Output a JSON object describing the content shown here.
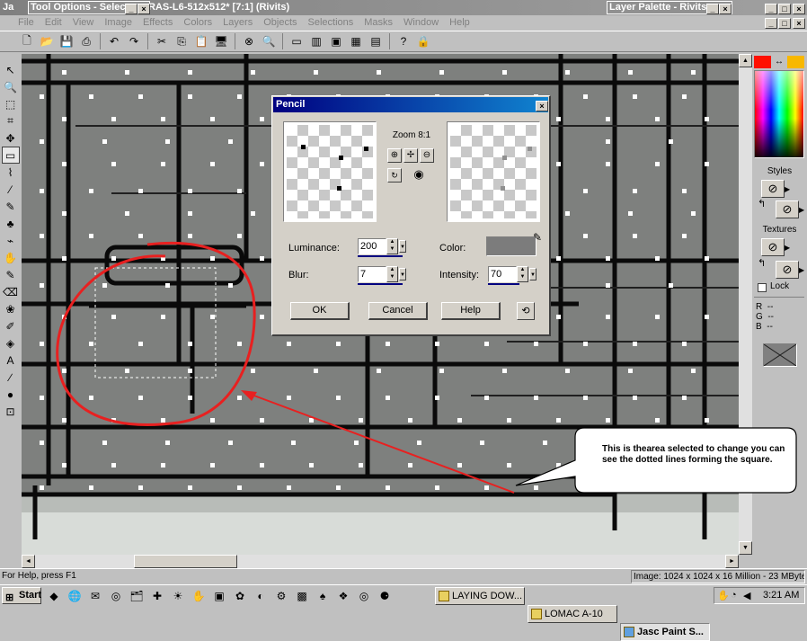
{
  "app": {
    "title_fragment": "Ja",
    "image_title": "RAS-L6-512x512* [7:1] (Rivits)"
  },
  "tool_options": {
    "title": "Tool Options - Selec"
  },
  "layer_palette": {
    "title": "Layer Palette - Rivits"
  },
  "menu": {
    "items": [
      "File",
      "Edit",
      "View",
      "Image",
      "Effects",
      "Colors",
      "Layers",
      "Objects",
      "Selections",
      "Masks",
      "Window",
      "Help"
    ]
  },
  "toolbar": {
    "icons": [
      "new-icon",
      "open-icon",
      "save-icon",
      "print-icon",
      "undo-icon",
      "redo-icon",
      "cut-icon",
      "copy-icon",
      "paste-icon",
      "browse-icon",
      "full-screen-icon",
      "zoom-icon",
      "toggle-toolbar-icon",
      "histogram-icon",
      "overview-icon",
      "color-palette-icon",
      "tool-options-icon",
      "help-icon",
      "lock-icon"
    ]
  },
  "tools": {
    "icons": [
      "arrow-icon",
      "zoom-tool-icon",
      "deform-icon",
      "crop-icon",
      "mover-icon",
      "selection-icon",
      "freehand-icon",
      "dropper-icon",
      "paintbrush-icon",
      "clone-icon",
      "color-replacer-icon",
      "retouch-icon",
      "scratch-remover-icon",
      "eraser-icon",
      "picture-tube-icon",
      "airbrush-icon",
      "flood-fill-icon",
      "text-icon",
      "draw-icon",
      "preset-shapes-icon",
      "object-selector-icon"
    ]
  },
  "dialog": {
    "title": "Pencil",
    "zoom_label": "Zoom 8:1",
    "luminance_label": "Luminance:",
    "luminance_value": "200",
    "blur_label": "Blur:",
    "blur_value": "7",
    "color_label": "Color:",
    "intensity_label": "Intensity:",
    "intensity_value": "70",
    "ok": "OK",
    "cancel": "Cancel",
    "help": "Help",
    "colors": {
      "swatch": "#7c7c7c"
    }
  },
  "palette": {
    "styles": "Styles",
    "textures": "Textures",
    "lock": "Lock",
    "r": "R",
    "g": "G",
    "b": "B",
    "r_val": "--",
    "g_val": "--",
    "b_val": "--",
    "colors": {
      "foreground": "#ff1000",
      "background": "#f8b800"
    }
  },
  "callout": {
    "text": "This is thearea selected to change you can see the dotted lines forming the square."
  },
  "status": {
    "help": "For Help, press F1",
    "image": "Image:  1024 x 1024 x 16 Million - 23 MBytes"
  },
  "taskbar": {
    "start": "Start",
    "tasks": [
      "LAYING DOW...",
      "LOMAC A-10",
      "Jasc Paint S..."
    ],
    "time": "3:21 AM"
  },
  "annotation": {
    "circle_color": "#e82020"
  }
}
